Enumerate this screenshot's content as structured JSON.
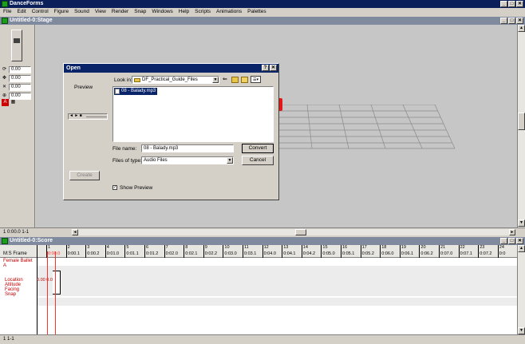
{
  "app": {
    "title": "DanceForms"
  },
  "menu": [
    "File",
    "Edit",
    "Control",
    "Figure",
    "Sound",
    "View",
    "Render",
    "Snap",
    "Windows",
    "Help",
    "Scripts",
    "Animations",
    "Palettes"
  ],
  "stage": {
    "title": "Untitled-0:Stage",
    "fields": [
      {
        "icon": "rotate-icon",
        "value": "0.00"
      },
      {
        "icon": "pan-icon",
        "value": "0.00"
      },
      {
        "icon": "cross-icon",
        "value": "0.00"
      },
      {
        "icon": "zoom-icon",
        "value": "0.00"
      }
    ],
    "status": "1 0:00.0 1-1"
  },
  "dialog": {
    "title": "Open",
    "look_in_label": "Look in:",
    "look_in_value": "DF_Practical_Guide_Files",
    "preview_label": "Preview",
    "files": [
      "08 - Balady.mp3"
    ],
    "file_name_label": "File name:",
    "file_name_value": "08 - Balady.mp3",
    "files_of_type_label": "Files of type:",
    "files_of_type_value": "Audio Files",
    "convert_label": "Convert",
    "cancel_label": "Cancel",
    "create_label": "Create",
    "show_preview_label": "Show Preview",
    "help_glyph": "?",
    "close_glyph": "✕"
  },
  "score": {
    "title": "Untitled-0:Score",
    "header_label": "M:S Frame",
    "figure_label": "Female Ballet A",
    "tracks": [
      "Location",
      "Altitude",
      "Facing",
      "Snap"
    ],
    "track_readout": "0.00 0.00",
    "ruler_numbers": [
      "1",
      "2",
      "3",
      "4",
      "5",
      "6",
      "7",
      "8",
      "9",
      "10",
      "11",
      "12",
      "13",
      "14",
      "15",
      "16",
      "17",
      "18",
      "19",
      "20",
      "21",
      "22",
      "23",
      "24"
    ],
    "ruler_times": [
      "0:00.0",
      "0:00.1",
      "0:00.2",
      "0:01.0",
      "0:01.1",
      "0:01.2",
      "0:02.0",
      "0:02.1",
      "0:02.2",
      "0:03.0",
      "0:03.1",
      "0:04.0",
      "0:04.1",
      "0:04.2",
      "0:05.0",
      "0:05.1",
      "0:05.2",
      "0:06.0",
      "0:06.1",
      "0:06.2",
      "0:07.0",
      "0:07.1",
      "0:07.2",
      "0:0"
    ],
    "status": "1 1-1"
  }
}
